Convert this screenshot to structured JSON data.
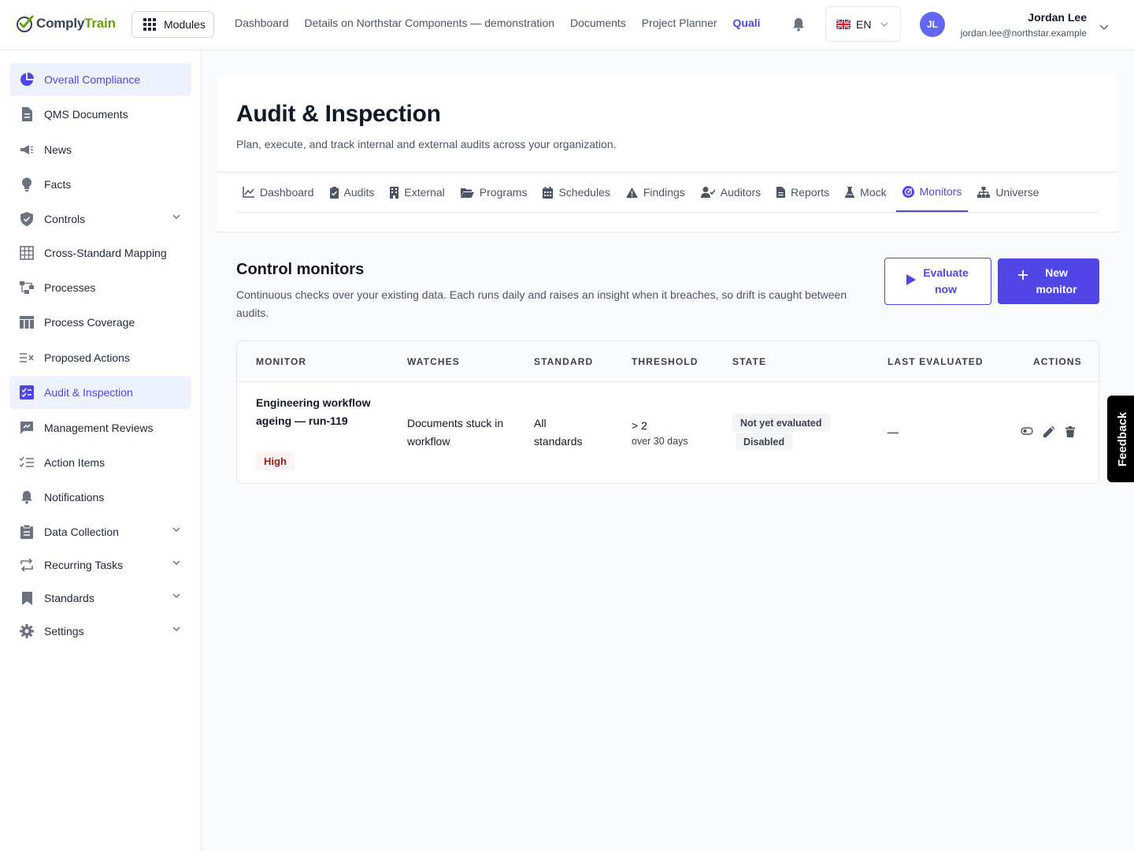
{
  "app": {
    "logo_part1": "Comply",
    "logo_part2": "Train",
    "modules_label": "Modules"
  },
  "topnav": {
    "items": [
      "Dashboard",
      "Details on Northstar Components — demonstration",
      "Documents",
      "Project Planner"
    ],
    "active": "Quali"
  },
  "language": {
    "code": "EN"
  },
  "user": {
    "initials": "JL",
    "name": "Jordan Lee",
    "email": "jordan.lee@northstar.example"
  },
  "sidebar": {
    "items": [
      {
        "label": "Overall Compliance",
        "icon": "pie-chart-icon",
        "active": true
      },
      {
        "label": "QMS Documents",
        "icon": "document-icon"
      },
      {
        "label": "News",
        "icon": "megaphone-icon"
      },
      {
        "label": "Facts",
        "icon": "lightbulb-icon"
      },
      {
        "label": "Controls",
        "icon": "shield-icon",
        "expandable": true
      },
      {
        "label": "Cross-Standard Mapping",
        "icon": "table-icon"
      },
      {
        "label": "Processes",
        "icon": "flow-icon"
      },
      {
        "label": "Process Coverage",
        "icon": "coverage-table-icon"
      },
      {
        "label": "Proposed Actions",
        "icon": "list-x-icon"
      },
      {
        "label": "Audit & Inspection",
        "icon": "audit-icon",
        "active": true
      },
      {
        "label": "Management Reviews",
        "icon": "review-icon"
      },
      {
        "label": "Action Items",
        "icon": "checklist-icon"
      },
      {
        "label": "Notifications",
        "icon": "bell-icon"
      },
      {
        "label": "Data Collection",
        "icon": "clipboard-icon",
        "expandable": true
      },
      {
        "label": "Recurring Tasks",
        "icon": "repeat-icon",
        "expandable": true
      },
      {
        "label": "Standards",
        "icon": "bookmark-icon",
        "expandable": true
      },
      {
        "label": "Settings",
        "icon": "gear-icon",
        "expandable": true
      }
    ]
  },
  "page": {
    "title": "Audit & Inspection",
    "subtitle": "Plan, execute, and track internal and external audits across your organization.",
    "tabs": [
      {
        "label": "Dashboard",
        "icon": "chart-line-icon"
      },
      {
        "label": "Audits",
        "icon": "clipboard-check-icon"
      },
      {
        "label": "External",
        "icon": "building-icon"
      },
      {
        "label": "Programs",
        "icon": "folder-open-icon"
      },
      {
        "label": "Schedules",
        "icon": "calendar-icon"
      },
      {
        "label": "Findings",
        "icon": "warning-icon"
      },
      {
        "label": "Auditors",
        "icon": "user-check-icon"
      },
      {
        "label": "Reports",
        "icon": "report-icon"
      },
      {
        "label": "Mock",
        "icon": "flask-icon"
      },
      {
        "label": "Monitors",
        "icon": "radar-icon",
        "active": true
      },
      {
        "label": "Universe",
        "icon": "sitemap-icon"
      }
    ]
  },
  "monitors": {
    "title": "Control monitors",
    "description": "Continuous checks over your existing data. Each runs daily and raises an insight when it breaches, so drift is caught between audits.",
    "evaluate_label": "Evaluate now",
    "new_label": "New monitor",
    "columns": [
      "MONITOR",
      "WATCHES",
      "STANDARD",
      "THRESHOLD",
      "STATE",
      "LAST EVALUATED",
      "ACTIONS"
    ],
    "rows": [
      {
        "monitor": "Engineering workflow ageing — run-119",
        "severity": "High",
        "watches": "Documents stuck in workflow",
        "standard": "All standards",
        "threshold": "> 2",
        "threshold_sub": "over 30 days",
        "state_primary": "Not yet evaluated",
        "state_secondary": "Disabled",
        "last_evaluated": "—"
      }
    ]
  },
  "feedback": {
    "label": "Feedback"
  }
}
